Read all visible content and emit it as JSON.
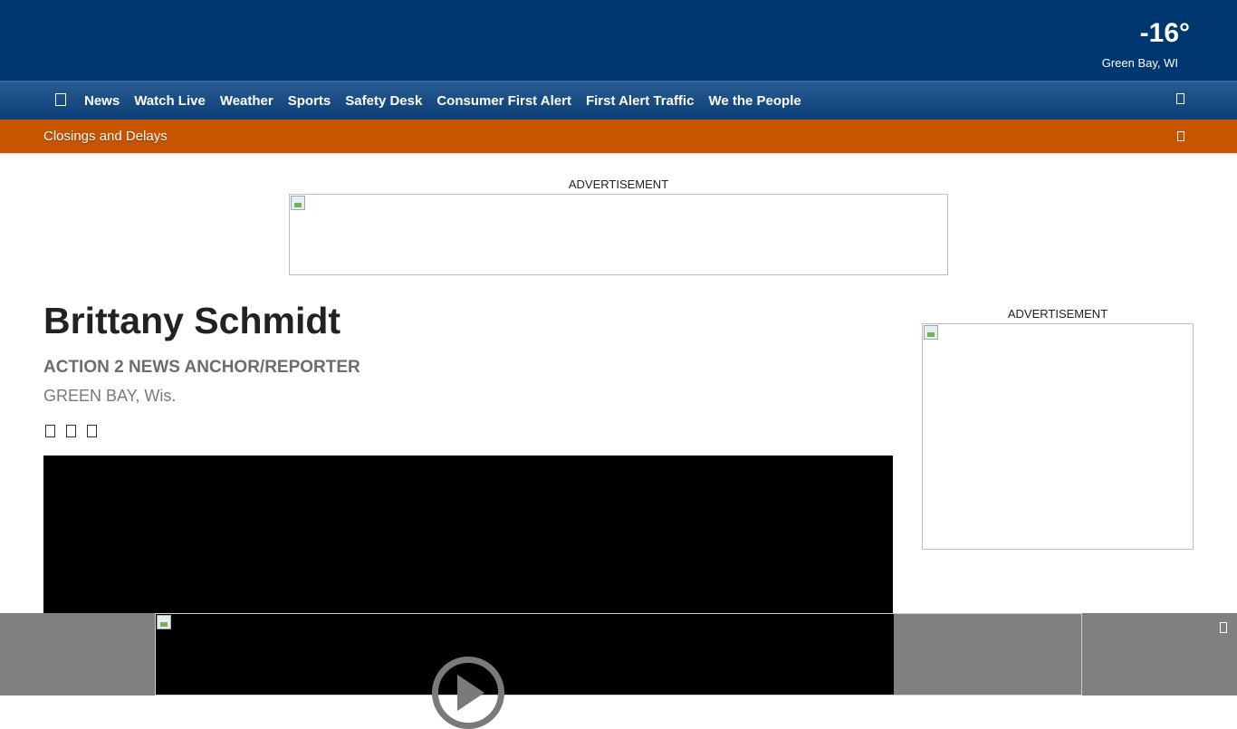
{
  "weather": {
    "temp": "-16°",
    "location": "Green Bay, WI"
  },
  "nav": {
    "menu_icon": "menu-icon",
    "items": [
      "News",
      "Watch Live",
      "Weather",
      "Sports",
      "Safety Desk",
      "Consumer First Alert",
      "First Alert Traffic",
      "We the People"
    ],
    "search_icon": "search-icon"
  },
  "alert_bar": {
    "label": "Closings and Delays",
    "icon": "chevron-down-icon"
  },
  "ads": {
    "top_label": "ADVERTISEMENT",
    "side_label": "ADVERTISEMENT"
  },
  "profile": {
    "name": "Brittany Schmidt",
    "title": "ACTION 2 NEWS ANCHOR/REPORTER",
    "location": "GREEN BAY, Wis.",
    "social_icons": [
      "facebook-icon",
      "twitter-icon",
      "email-icon"
    ]
  },
  "video": {
    "play_icon": "play-icon"
  },
  "bottom_ad": {
    "close_icon": "close-icon"
  },
  "colors": {
    "header": "#003770",
    "nav": "#1a4b82",
    "alert": "#c85400"
  }
}
